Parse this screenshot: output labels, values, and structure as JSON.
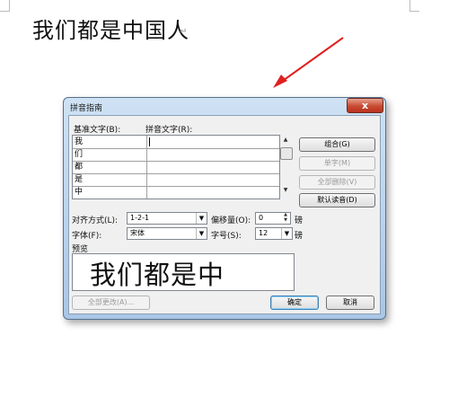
{
  "document": {
    "text": "我们都是中国人",
    "para_mark": "↵"
  },
  "dialog": {
    "title": "拼音指南",
    "close_glyph": "x",
    "base_text_label": "基准文字(B):",
    "pinyin_text_label": "拼音文字(R):",
    "rows": [
      {
        "base": "我",
        "pinyin": ""
      },
      {
        "base": "们",
        "pinyin": ""
      },
      {
        "base": "都",
        "pinyin": ""
      },
      {
        "base": "是",
        "pinyin": ""
      },
      {
        "base": "中",
        "pinyin": ""
      }
    ],
    "buttons": {
      "combine": "组合(G)",
      "single_char": "单字(M)",
      "delete_all": "全部删除(V)",
      "default_reading": "默认读音(D)",
      "change_all": "全部更改(A)...",
      "ok": "确定",
      "cancel": "取消"
    },
    "alignment_label": "对齐方式(L):",
    "alignment_value": "1-2-1",
    "offset_label": "偏移量(O):",
    "offset_value": "0",
    "offset_unit": "磅",
    "font_label": "字体(F):",
    "font_value": "宋体",
    "size_label": "字号(S):",
    "size_value": "12",
    "size_unit": "磅",
    "preview_label": "预览",
    "preview_text": "我们都是中",
    "combo_arrow": "▼",
    "scroll_up": "▲",
    "scroll_down": "▼",
    "spin_up": "▲",
    "spin_down": "▼"
  },
  "colors": {
    "arrow": "#e02020",
    "title_bar": "#bcd5ee",
    "close_button": "#c84a32"
  }
}
